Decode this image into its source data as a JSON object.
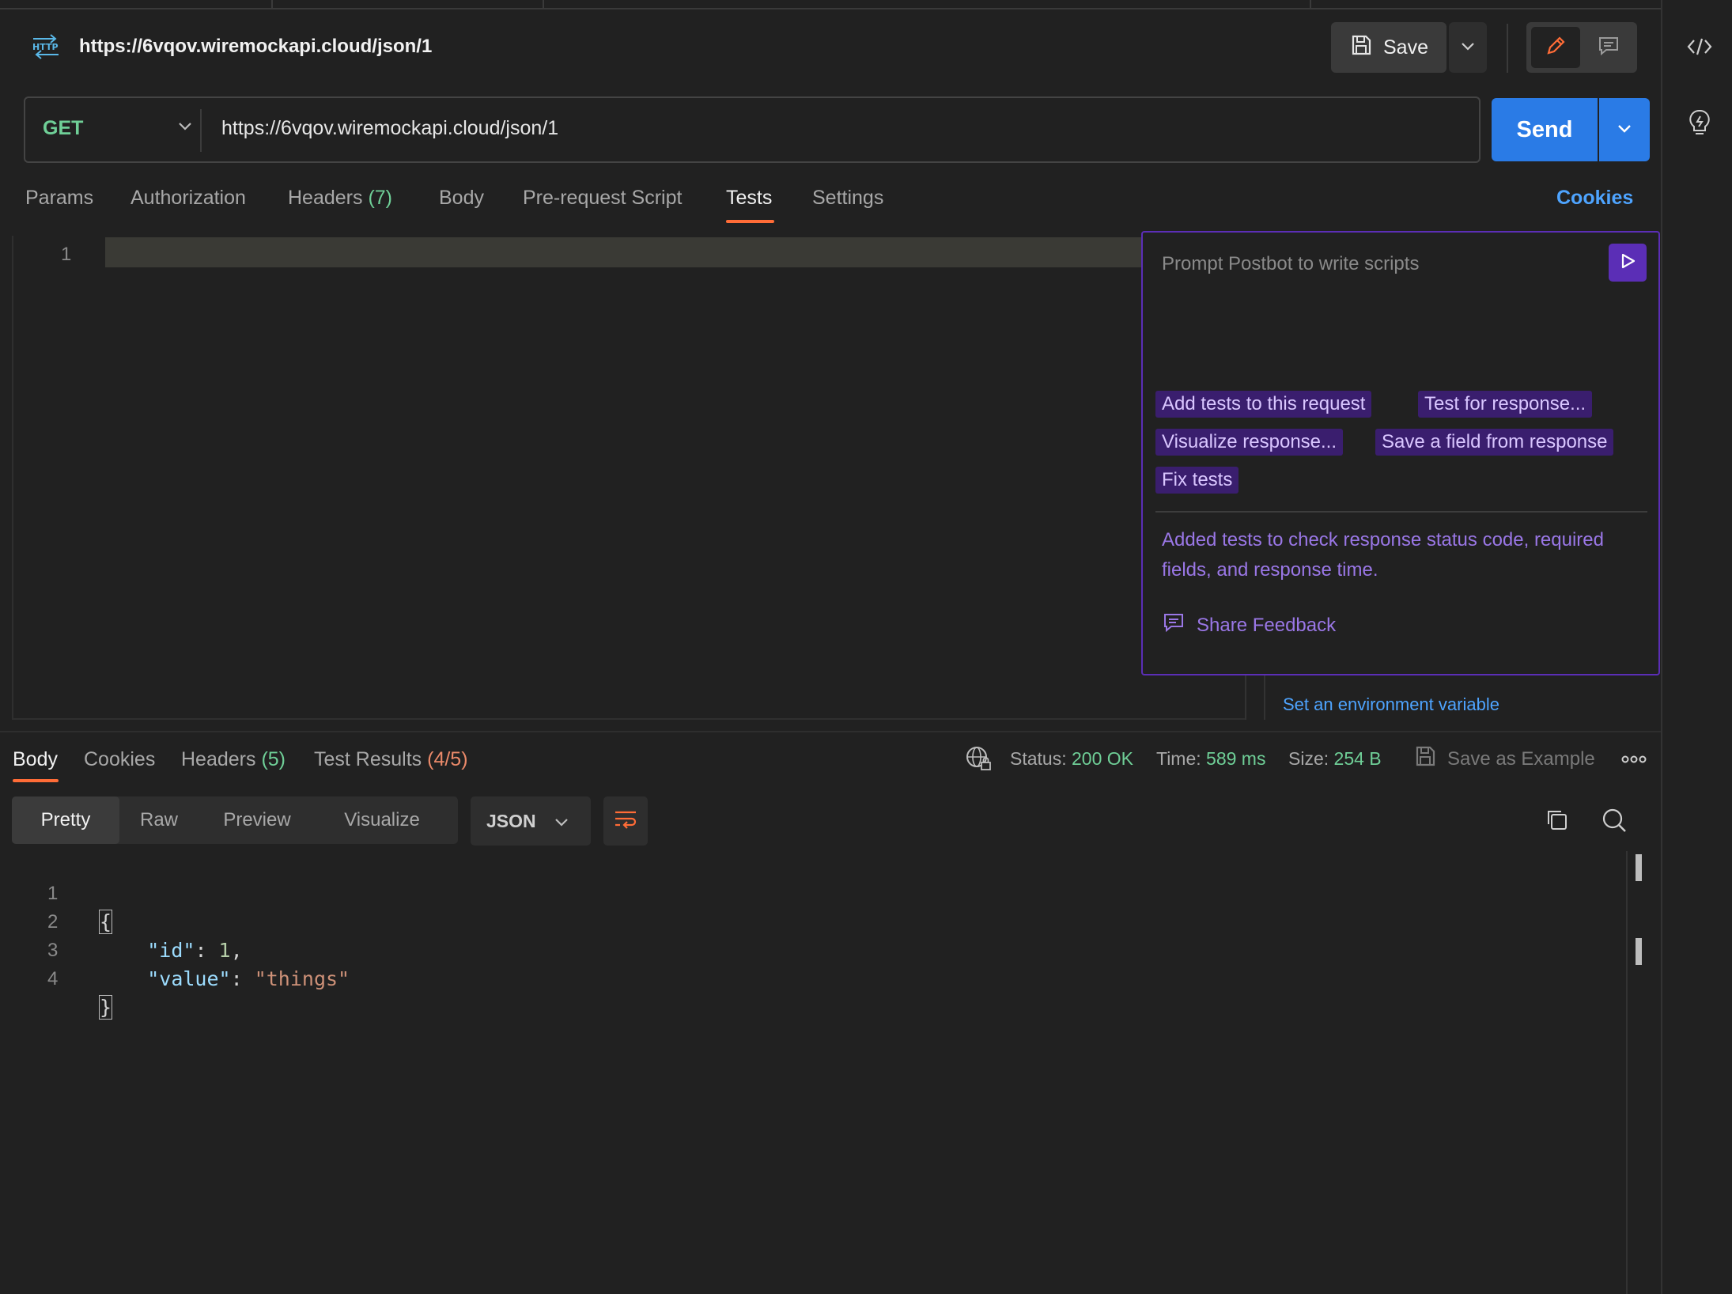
{
  "header": {
    "title": "https://6vqov.wiremockapi.cloud/json/1",
    "save_label": "Save"
  },
  "request": {
    "method": "GET",
    "url": "https://6vqov.wiremockapi.cloud/json/1",
    "send_label": "Send"
  },
  "request_tabs": [
    {
      "label": "Params"
    },
    {
      "label": "Authorization"
    },
    {
      "label": "Headers",
      "count": "(7)"
    },
    {
      "label": "Body"
    },
    {
      "label": "Pre-request Script"
    },
    {
      "label": "Tests"
    },
    {
      "label": "Settings"
    }
  ],
  "cookies_link": "Cookies",
  "editor": {
    "line_number": "1"
  },
  "postbot": {
    "placeholder": "Prompt Postbot to write scripts",
    "suggestions": [
      "Add tests to this request",
      "Test for response...",
      "Visualize response...",
      "Save a field from response",
      "Fix tests"
    ],
    "message": "Added tests to check response status code, required fields, and response time.",
    "feedback_label": "Share Feedback"
  },
  "env_link": "Set an environment variable",
  "response": {
    "tabs": [
      {
        "label": "Body"
      },
      {
        "label": "Cookies"
      },
      {
        "label": "Headers",
        "count": "(5)"
      },
      {
        "label": "Test Results",
        "count": "(4/5)"
      }
    ],
    "status_label": "Status:",
    "status_value": "200 OK",
    "time_label": "Time:",
    "time_value": "589 ms",
    "size_label": "Size:",
    "size_value": "254 B",
    "save_example": "Save as Example",
    "format_buttons": [
      "Pretty",
      "Raw",
      "Preview",
      "Visualize"
    ],
    "language": "JSON",
    "code": {
      "line_numbers": [
        "1",
        "2",
        "3",
        "4"
      ],
      "open_brace": "{",
      "close_brace": "}",
      "id_key": "\"id\"",
      "id_value": "1",
      "value_key": "\"value\"",
      "value_value": "\"things\""
    }
  },
  "colors": {
    "accent_send": "#2a7be6",
    "active_tab": "#ff6c37",
    "postbot": "#5b2eb6",
    "status_ok": "#6fcf97"
  }
}
